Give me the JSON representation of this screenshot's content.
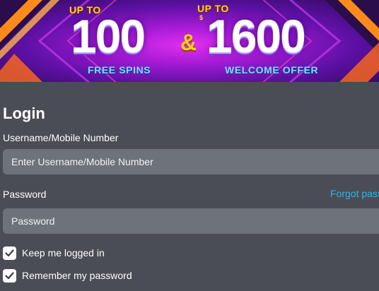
{
  "banner": {
    "left_offer": {
      "prefix": "UP TO",
      "amount": "100",
      "caption": "FREE SPINS"
    },
    "connector": "&",
    "right_offer": {
      "prefix": "UP TO",
      "currency": "$",
      "amount": "1600",
      "caption": "WELCOME OFFER"
    }
  },
  "login": {
    "title": "Login",
    "username": {
      "label": "Username/Mobile Number",
      "placeholder": "Enter Username/Mobile Number"
    },
    "password": {
      "label": "Password",
      "placeholder": "Password",
      "forgot_link": "Forgot passw"
    },
    "keep_logged_in": {
      "label": "Keep me logged in",
      "checked": true
    },
    "remember_password": {
      "label": "Remember my password",
      "checked": true
    }
  },
  "colors": {
    "page_background": "#4b4d56",
    "input_background": "#6d727b",
    "link": "#29b6e6",
    "banner_purple": "#a31ad4",
    "banner_gold": "#ffd21f",
    "banner_cyan": "#6fe3ff"
  },
  "icons": [
    "checkmark-icon"
  ]
}
